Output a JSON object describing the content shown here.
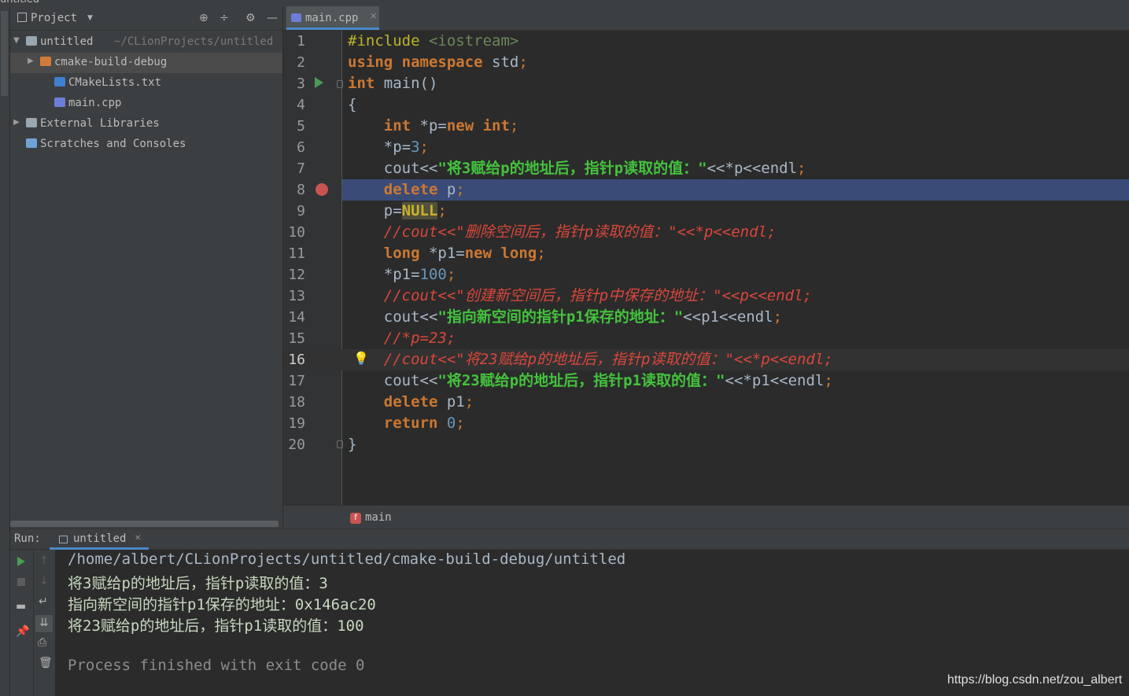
{
  "window": {
    "title": "untitled",
    "file": "main.cpp"
  },
  "project_panel": {
    "title": "Project",
    "tree": [
      {
        "label": "untitled",
        "path": "~/CLionProjects/untitled",
        "icon": "folder-icon",
        "expanded": true
      },
      {
        "label": "cmake-build-debug",
        "icon": "folder-orange-icon",
        "expanded": false,
        "selected": true
      },
      {
        "label": "CMakeLists.txt",
        "icon": "cmake-icon"
      },
      {
        "label": "main.cpp",
        "icon": "cpp-file-icon"
      },
      {
        "label": "External Libraries",
        "icon": "library-icon",
        "expanded": false
      },
      {
        "label": "Scratches and Consoles",
        "icon": "scratches-icon"
      }
    ]
  },
  "editor": {
    "tab_label": "main.cpp",
    "breadcrumb": "main",
    "breakpoint_line": 8,
    "current_line": 16,
    "lines": [
      [
        {
          "t": "#include ",
          "c": "pp"
        },
        {
          "t": "<iostream>",
          "c": "inc"
        }
      ],
      [
        {
          "t": "using namespace ",
          "c": "kw"
        },
        {
          "t": "std",
          "c": "id"
        },
        {
          "t": ";",
          "c": "pn"
        }
      ],
      [
        {
          "t": "int ",
          "c": "kw"
        },
        {
          "t": "main()",
          "c": "id"
        }
      ],
      [
        {
          "t": "{",
          "c": "id"
        }
      ],
      [
        {
          "t": "    int ",
          "c": "kw"
        },
        {
          "t": "*p=",
          "c": "id"
        },
        {
          "t": "new int",
          "c": "kw"
        },
        {
          "t": ";",
          "c": "pn"
        }
      ],
      [
        {
          "t": "    *p=",
          "c": "id"
        },
        {
          "t": "3",
          "c": "num"
        },
        {
          "t": ";",
          "c": "pn"
        }
      ],
      [
        {
          "t": "    cout",
          "c": "id"
        },
        {
          "t": "<<",
          "c": "op"
        },
        {
          "t": "\"将3赋给p的地址后，指针p读取的值：\"",
          "c": "str"
        },
        {
          "t": "<<",
          "c": "op"
        },
        {
          "t": "*p",
          "c": "id"
        },
        {
          "t": "<<",
          "c": "op"
        },
        {
          "t": "endl",
          "c": "id"
        },
        {
          "t": ";",
          "c": "pn"
        }
      ],
      [
        {
          "t": "    delete ",
          "c": "kw"
        },
        {
          "t": "p",
          "c": "id"
        },
        {
          "t": ";",
          "c": "pn"
        }
      ],
      [
        {
          "t": "    p=",
          "c": "id"
        },
        {
          "t": "NULL",
          "c": "null"
        },
        {
          "t": ";",
          "c": "pn"
        }
      ],
      [
        {
          "t": "    //cout<<\"删除空间后，指针p读取的值：\"<<*p<<endl;",
          "c": "cm"
        }
      ],
      [
        {
          "t": "    long ",
          "c": "kw"
        },
        {
          "t": "*p1=",
          "c": "id"
        },
        {
          "t": "new long",
          "c": "kw"
        },
        {
          "t": ";",
          "c": "pn"
        }
      ],
      [
        {
          "t": "    *p1=",
          "c": "id"
        },
        {
          "t": "100",
          "c": "num"
        },
        {
          "t": ";",
          "c": "pn"
        }
      ],
      [
        {
          "t": "    //cout<<\"创建新空间后，指针p中保存的地址：\"<<p<<endl;",
          "c": "cm"
        }
      ],
      [
        {
          "t": "    cout",
          "c": "id"
        },
        {
          "t": "<<",
          "c": "op"
        },
        {
          "t": "\"指向新空间的指针p1保存的地址：\"",
          "c": "str"
        },
        {
          "t": "<<",
          "c": "op"
        },
        {
          "t": "p1",
          "c": "id"
        },
        {
          "t": "<<",
          "c": "op"
        },
        {
          "t": "endl",
          "c": "id"
        },
        {
          "t": ";",
          "c": "pn"
        }
      ],
      [
        {
          "t": "    //*p=23;",
          "c": "cm"
        }
      ],
      [
        {
          "t": "    //cout<<\"将23赋给p的地址后，指针p读取的值：\"<<*p<<endl;",
          "c": "cm"
        }
      ],
      [
        {
          "t": "    cout",
          "c": "id"
        },
        {
          "t": "<<",
          "c": "op"
        },
        {
          "t": "\"将23赋给p的地址后，指针p1读取的值：\"",
          "c": "str"
        },
        {
          "t": "<<",
          "c": "op"
        },
        {
          "t": "*p1",
          "c": "id"
        },
        {
          "t": "<<",
          "c": "op"
        },
        {
          "t": "endl",
          "c": "id"
        },
        {
          "t": ";",
          "c": "pn"
        }
      ],
      [
        {
          "t": "    delete ",
          "c": "kw"
        },
        {
          "t": "p1",
          "c": "id"
        },
        {
          "t": ";",
          "c": "pn"
        }
      ],
      [
        {
          "t": "    return ",
          "c": "kw"
        },
        {
          "t": "0",
          "c": "num"
        },
        {
          "t": ";",
          "c": "pn"
        }
      ],
      [
        {
          "t": "}",
          "c": "id"
        }
      ]
    ]
  },
  "run_panel": {
    "label": "Run:",
    "tab_label": "untitled",
    "output": [
      "/home/albert/CLionProjects/untitled/cmake-build-debug/untitled",
      "将3赋给p的地址后，指针p读取的值：3",
      "指向新空间的指针p1保存的地址：0x146ac20",
      "将23赋给p的地址后，指针p1读取的值：100",
      "",
      "Process finished with exit code 0"
    ]
  },
  "watermark": "https://blog.csdn.net/zou_albert",
  "colors": {
    "keyword": "#cc7832",
    "preprocessor": "#bbb529",
    "include": "#6a8759",
    "string": "#43c23d",
    "number": "#6897bb",
    "comment": "#d9473b",
    "null_bg": "#52503a",
    "null_fg": "#c8b22d",
    "breakpoint": "#c75450",
    "run_green": "#499c54",
    "bp_line_bg": "#3a4b78"
  }
}
